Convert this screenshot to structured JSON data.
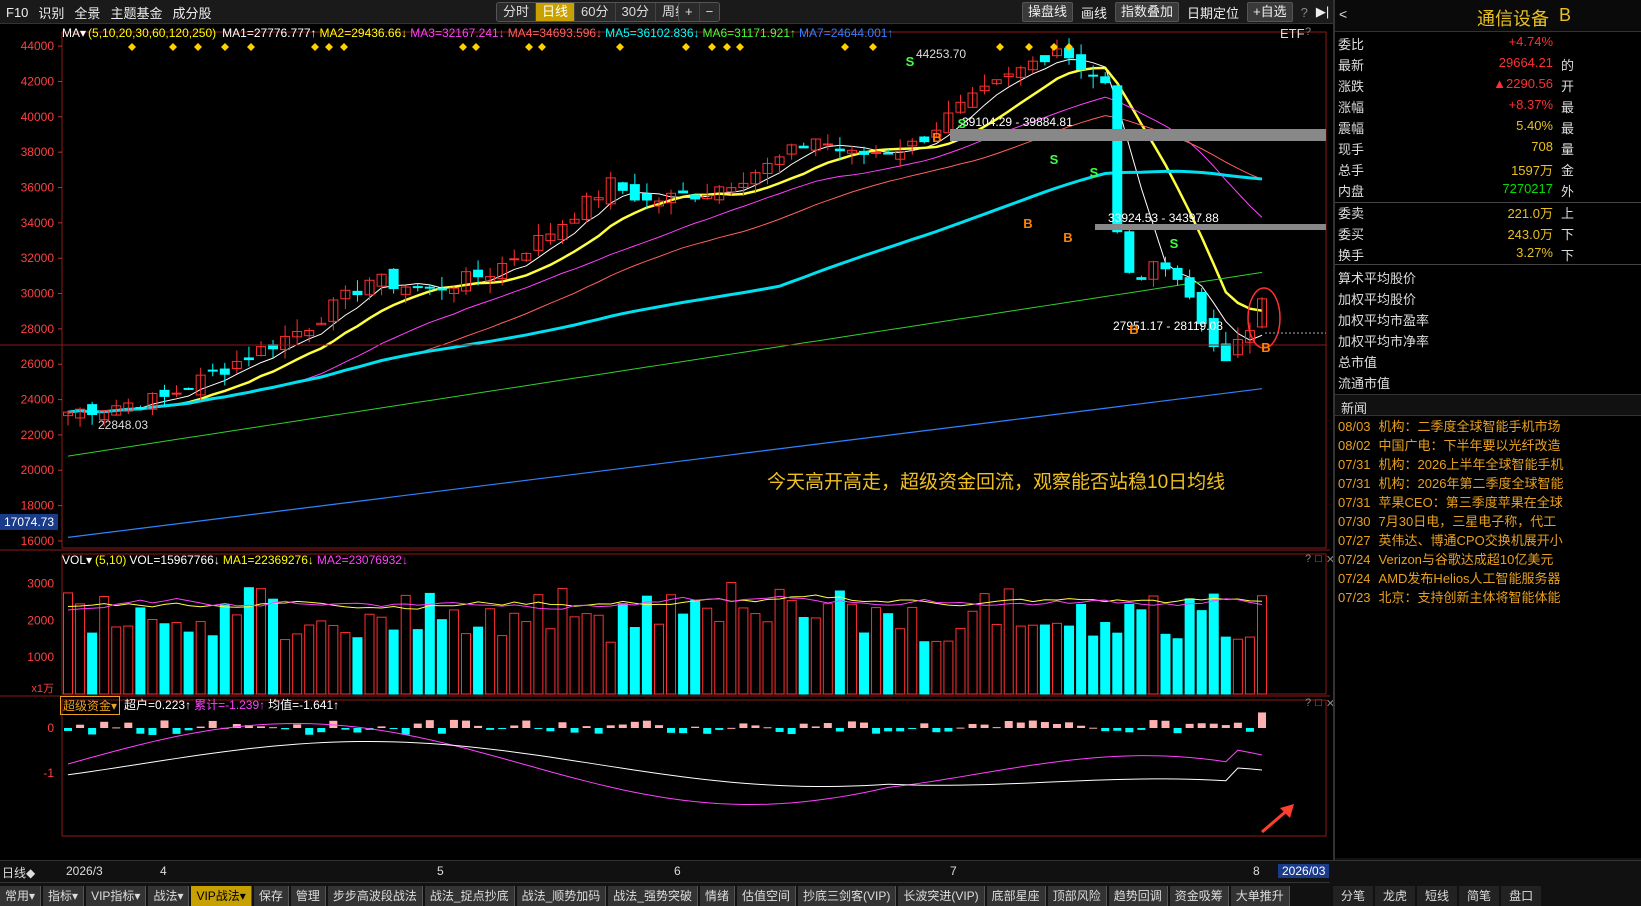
{
  "toolbar": {
    "left_items": [
      "F10",
      "识别",
      "全景",
      "主题基金",
      "成分股"
    ],
    "period_tabs": [
      "分时",
      "日线",
      "60分",
      "30分",
      "周线"
    ],
    "active_period": "日线",
    "period_more": "▾",
    "zoom_in": "+",
    "zoom_out": "−",
    "right_items": {
      "overlay": "操盘线",
      "draw": "画线",
      "index_overlay": "指数叠加",
      "date_locate": "日期定位",
      "custom_pick": "+自选",
      "help": "?",
      "sidebar": "▶|"
    }
  },
  "main_chart": {
    "ma_label": "MA▾",
    "ma_params": "(5,10,20,30,60,120,250)",
    "ma_values": [
      {
        "text": "MA1=27776.777↑",
        "color": "#ffffff"
      },
      {
        "text": "MA2=29436.66↓",
        "color": "#ffff00"
      },
      {
        "text": "MA3=32167.241↓",
        "color": "#ff40ff"
      },
      {
        "text": "MA4=34693.596↓",
        "color": "#ff6060"
      },
      {
        "text": "MA5=36102.836↓",
        "color": "#00ffff"
      },
      {
        "text": "MA6=31171.921↑",
        "color": "#40ff40"
      },
      {
        "text": "MA7=24644.001↑",
        "color": "#3080ff"
      }
    ],
    "etf_label": "ETF",
    "price_ticks": [
      "44000",
      "42000",
      "40000",
      "38000",
      "36000",
      "34000",
      "32000",
      "30000",
      "28000",
      "26000",
      "24000",
      "22000",
      "20000",
      "18000",
      "16000"
    ],
    "current_price_tag": "17074.73",
    "annotations": {
      "high": "44253.70",
      "low": "22848.03",
      "zone1": "39104.29 - 39884.81",
      "zone2": "33924.53 - 34397.88",
      "zone3": "27951.17 - 28119.08",
      "comment": "今天高开高走，超级资金回流，观察能否站稳10日均线"
    },
    "signal_buy": "B",
    "signal_sell": "S"
  },
  "volume_chart": {
    "label": "VOL▾",
    "params": "(5,10)",
    "values": [
      {
        "text": "VOL=15967766↓",
        "color": "#ffffff"
      },
      {
        "text": "MA1=22369276↓",
        "color": "#ffff00"
      },
      {
        "text": "MA2=23076932↓",
        "color": "#ff40ff"
      }
    ],
    "ticks": [
      "3000",
      "2000",
      "1000"
    ],
    "unit": "x1万"
  },
  "fund_chart": {
    "label": "超级资金▾",
    "values": [
      {
        "text": "超户=0.223↑",
        "color": "#ffffff"
      },
      {
        "text": "累计=-1.239↑",
        "color": "#ff40ff"
      },
      {
        "text": "均值=-1.641↑",
        "color": "#ffffff"
      }
    ],
    "ticks": [
      "0",
      "-1"
    ]
  },
  "date_axis": {
    "period_label": "日线◆",
    "labels": [
      "2026/3",
      "4",
      "5",
      "6",
      "7",
      "8"
    ],
    "current_date": "2026/03"
  },
  "panel_controls": {
    "help": "?",
    "restore": "□",
    "close": "✕"
  },
  "right_panel": {
    "back": "<",
    "title": "通信设备",
    "title_suffix": "B",
    "rows": [
      {
        "k": "委比",
        "v": "+4.74%",
        "vc": "red",
        "t": ""
      },
      {
        "k": "最新",
        "v": "29664.21",
        "vc": "red",
        "t": "的"
      },
      {
        "k": "涨跌",
        "v": "▲2290.56",
        "vc": "red",
        "t": "开"
      },
      {
        "k": "涨幅",
        "v": "+8.37%",
        "vc": "red",
        "t": "最"
      },
      {
        "k": "震幅",
        "v": "5.40%",
        "vc": "yel",
        "t": "最"
      },
      {
        "k": "现手",
        "v": "708",
        "vc": "yel",
        "t": "量"
      },
      {
        "k": "总手",
        "v": "1597万",
        "vc": "yel",
        "t": "金"
      },
      {
        "k": "内盘",
        "v": "7270217",
        "vc": "green",
        "t": "外"
      },
      {
        "k": "委卖",
        "v": "221.0万",
        "vc": "yel",
        "t": "上"
      },
      {
        "k": "委买",
        "v": "243.0万",
        "vc": "yel",
        "t": "下"
      },
      {
        "k": "换手",
        "v": "3.27%",
        "vc": "yel",
        "t": "下"
      }
    ],
    "stats": [
      "算术平均股价",
      "加权平均股价",
      "加权平均市盈率",
      "加权平均市净率",
      "总市值",
      "流通市值"
    ],
    "news_header": "新闻",
    "news": [
      {
        "d": "08/03",
        "t": "机构：二季度全球智能手机市场"
      },
      {
        "d": "08/02",
        "t": "中国广电：下半年要以光纤改造"
      },
      {
        "d": "07/31",
        "t": "机构：2026上半年全球智能手机"
      },
      {
        "d": "07/31",
        "t": "机构：2026年第二季度全球智能"
      },
      {
        "d": "07/31",
        "t": "苹果CEO：第三季度苹果在全球"
      },
      {
        "d": "07/30",
        "t": "7月30日电，三星电子称，代工"
      },
      {
        "d": "07/27",
        "t": "英伟达、博通CPO交换机展开小"
      },
      {
        "d": "07/24",
        "t": "Verizon与谷歌达成超10亿美元"
      },
      {
        "d": "07/24",
        "t": "AMD发布Helios人工智能服务器"
      },
      {
        "d": "07/23",
        "t": "北京：支持创新主体将智能体能"
      }
    ],
    "bottom_tabs": [
      "分笔",
      "龙虎",
      "短线",
      "简笔",
      "盘口"
    ]
  },
  "bottom_tabs": [
    "常用▾",
    "指标▾",
    "VIP指标▾",
    "战法▾",
    "VIP战法▾",
    "保存",
    "管理",
    "步步高波段战法",
    "战法_捉点抄底",
    "战法_顺势加码",
    "战法_强势突破",
    "情绪",
    "估值空间",
    "抄底三剑客(VIP)",
    "长波突进(VIP)",
    "底部星座",
    "顶部风险",
    "趋势回调",
    "资金吸筹",
    "大单推升"
  ],
  "active_bottom_tab": "VIP战法▾",
  "colors": {
    "up": "#ff3030",
    "down": "#00ffff",
    "accent": "#c8a000"
  }
}
